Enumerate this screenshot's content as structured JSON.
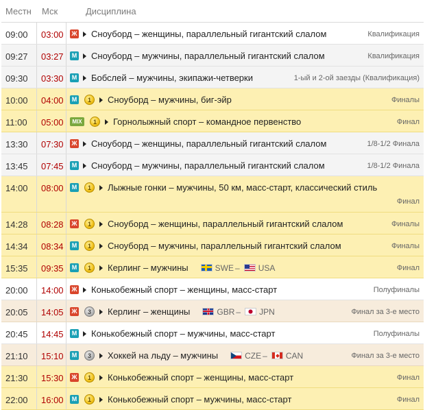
{
  "header": {
    "local": "Местн",
    "msk": "Мск",
    "discipline": "Дисциплина"
  },
  "rows": [
    {
      "local": "09:00",
      "msk": "03:00",
      "gender": "Ж",
      "medal": null,
      "discipline": "Сноуборд – женщины, параллельный гигантский слалом",
      "stage": "Квалификация",
      "bg": "white"
    },
    {
      "local": "09:27",
      "msk": "03:27",
      "gender": "М",
      "medal": null,
      "discipline": "Сноуборд – мужчины, параллельный гигантский слалом",
      "stage": "Квалификация",
      "bg": "gray"
    },
    {
      "local": "09:30",
      "msk": "03:30",
      "gender": "М",
      "medal": null,
      "discipline": "Бобслей – мужчины, экипажи-четверки",
      "stage": "1-ый и 2-ой заезды (Квалификация)",
      "bg": "gray"
    },
    {
      "local": "10:00",
      "msk": "04:00",
      "gender": "М",
      "medal": "1",
      "discipline": "Сноуборд – мужчины, биг-эйр",
      "stage": "Финалы",
      "bg": "yellow"
    },
    {
      "local": "11:00",
      "msk": "05:00",
      "gender": "MIX",
      "medal": "1",
      "discipline": "Горнолыжный спорт – командное первенство",
      "stage": "Финал",
      "bg": "yellow"
    },
    {
      "local": "13:30",
      "msk": "07:30",
      "gender": "Ж",
      "medal": null,
      "discipline": "Сноуборд – женщины, параллельный гигантский слалом",
      "stage": "1/8-1/2 Финала",
      "bg": "gray"
    },
    {
      "local": "13:45",
      "msk": "07:45",
      "gender": "М",
      "medal": null,
      "discipline": "Сноуборд – мужчины, параллельный гигантский слалом",
      "stage": "1/8-1/2 Финала",
      "bg": "gray"
    },
    {
      "local": "14:00",
      "msk": "08:00",
      "gender": "М",
      "medal": "1",
      "discipline": "Лыжные гонки – мужчины, 50 км, масс-старт, классический стиль",
      "stage": "Финал",
      "bg": "yellow",
      "twoLine": true
    },
    {
      "local": "14:28",
      "msk": "08:28",
      "gender": "Ж",
      "medal": "1",
      "discipline": "Сноуборд – женщины, параллельный гигантский слалом",
      "stage": "Финалы",
      "bg": "yellow"
    },
    {
      "local": "14:34",
      "msk": "08:34",
      "gender": "М",
      "medal": "1",
      "discipline": "Сноуборд – мужчины, параллельный гигантский слалом",
      "stage": "Финалы",
      "bg": "yellow"
    },
    {
      "local": "15:35",
      "msk": "09:35",
      "gender": "М",
      "medal": "1",
      "discipline": "Керлинг – мужчины",
      "teamA": "SWE",
      "flagA": "swe",
      "teamB": "USA",
      "flagB": "usa",
      "stage": "Финал",
      "bg": "yellow"
    },
    {
      "local": "20:00",
      "msk": "14:00",
      "gender": "Ж",
      "medal": null,
      "discipline": "Конькобежный спорт – женщины, масс-старт",
      "stage": "Полуфиналы",
      "bg": "white"
    },
    {
      "local": "20:05",
      "msk": "14:05",
      "gender": "Ж",
      "medal": "3",
      "discipline": "Керлинг – женщины",
      "teamA": "GBR",
      "flagA": "gbr",
      "teamB": "JPN",
      "flagB": "jpn",
      "stage": "Финал за 3-е место",
      "bg": "beige"
    },
    {
      "local": "20:45",
      "msk": "14:45",
      "gender": "М",
      "medal": null,
      "discipline": "Конькобежный спорт – мужчины, масс-старт",
      "stage": "Полуфиналы",
      "bg": "white"
    },
    {
      "local": "21:10",
      "msk": "15:10",
      "gender": "М",
      "medal": "3",
      "discipline": "Хоккей на льду – мужчины",
      "teamA": "CZE",
      "flagA": "cze",
      "teamB": "CAN",
      "flagB": "can",
      "stage": "Финал за 3-е место",
      "bg": "beige"
    },
    {
      "local": "21:30",
      "msk": "15:30",
      "gender": "Ж",
      "medal": "1",
      "discipline": "Конькобежный спорт – женщины, масс-старт",
      "stage": "Финал",
      "bg": "yellow"
    },
    {
      "local": "22:00",
      "msk": "16:00",
      "gender": "М",
      "medal": "1",
      "discipline": "Конькобежный спорт – мужчины, масс-старт",
      "stage": "Финал",
      "bg": "yellow"
    }
  ]
}
